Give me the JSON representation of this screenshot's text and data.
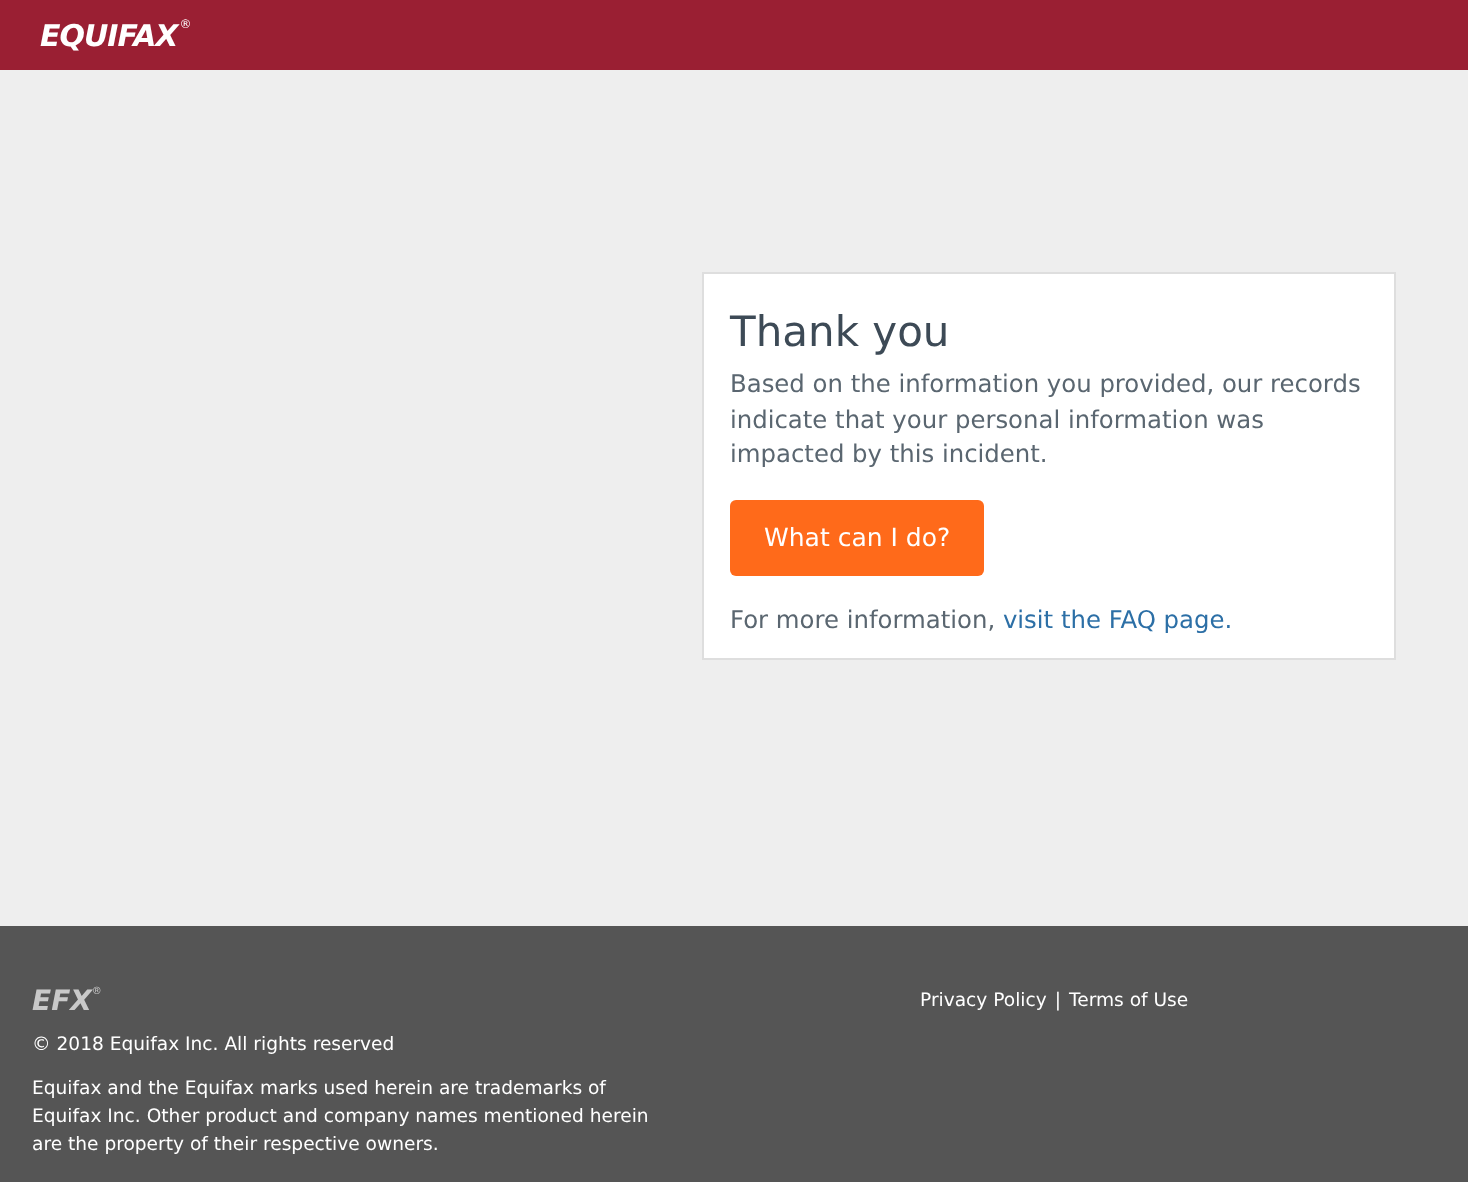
{
  "header": {
    "logo": "EQUIFAX",
    "logo_mark": "®"
  },
  "card": {
    "title": "Thank you",
    "message": "Based on the information you provided, our records indicate that your personal information was impacted by this incident.",
    "button": "What can I do?",
    "more_info": "For more information, ",
    "more_info_link": "visit the FAQ page."
  },
  "footer": {
    "logo": "EFX",
    "logo_mark": "®",
    "copyright": "© 2018 Equifax Inc. All rights reserved",
    "trademark_notice": "Equifax and the Equifax marks used herein are trademarks of Equifax Inc. Other product and company names mentioned herein are the property of their respective owners.",
    "links": [
      {
        "label": "Privacy Policy"
      },
      {
        "label": "Terms of Use"
      }
    ],
    "link_separator": "|"
  }
}
